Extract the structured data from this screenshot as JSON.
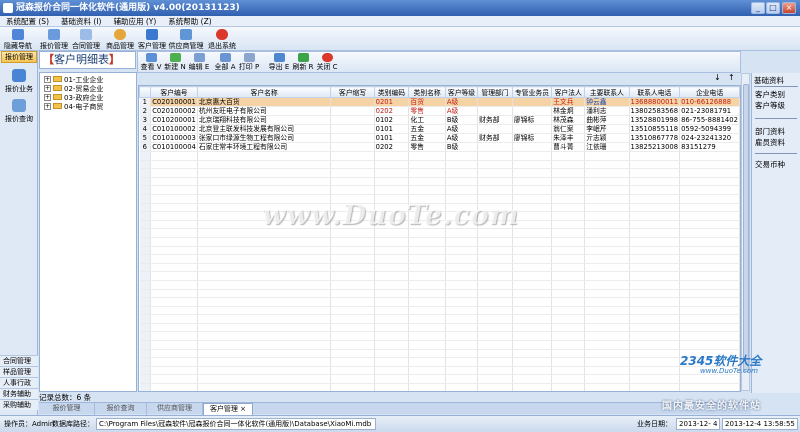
{
  "window": {
    "title": "冠森报价合同一体化软件(通用版) v4.00(20131123)",
    "controls": [
      "_",
      "□",
      "×"
    ]
  },
  "menu": [
    "系统配置 (S)",
    "基础资料 (I)",
    "辅助应用 (Y)",
    "系统帮助 (Z)"
  ],
  "toolbar": [
    "隐藏导航",
    "报价管理",
    "合同管理",
    "商品管理",
    "客户管理",
    "供应商管理",
    "退出系统"
  ],
  "nav": {
    "header": "报价管理",
    "items": [
      "报价业务",
      "报价查询"
    ],
    "bottom": [
      "合同管理",
      "样品管理",
      "人事行政",
      "财务辅助",
      "采购辅助"
    ]
  },
  "content": {
    "title": "客户明细表",
    "toolbar": [
      "查看 V",
      "新建 N",
      "编辑 E",
      "全部 A",
      "打印 P",
      "导出 E",
      "刷新 R",
      "关闭 C"
    ],
    "sort_controls": [
      "↓",
      "↑"
    ]
  },
  "tree": {
    "items": [
      "01-工业企业",
      "02-贸易企业",
      "03-政府企业",
      "04-电子商贸"
    ]
  },
  "table": {
    "columns": [
      "",
      "客户编号",
      "客户名称",
      "客户缩写",
      "类别编码",
      "类别名称",
      "客户等级",
      "管理部门",
      "专管业务员",
      "客户法人",
      "主要联系人",
      "联系人电话",
      "企业电话"
    ],
    "rows": [
      {
        "rn": "1",
        "sel": true,
        "cells": [
          "C020100001",
          "北京惠大百货",
          "",
          "0201",
          "百货",
          "A级",
          "",
          "",
          "王文兵",
          "钟云鑫",
          "13688800011",
          "010-66126888"
        ]
      },
      {
        "rn": "2",
        "sel": false,
        "cells": [
          "C020100002",
          "杭州友旺电子有限公司",
          "",
          "0202",
          "零售",
          "A级",
          "",
          "",
          "林金炯",
          "潘利志",
          "13802583568",
          "021-23081791"
        ]
      },
      {
        "rn": "3",
        "sel": false,
        "cells": [
          "C010200001",
          "北京瑞翔科技有限公司",
          "",
          "0102",
          "化工",
          "B级",
          "财务部",
          "廖锦标",
          "林茂森",
          "曲彬萍",
          "13528801998",
          "86-755-8881402"
        ]
      },
      {
        "rn": "4",
        "sel": false,
        "cells": [
          "C010100002",
          "北京登主联发科技发展有限公司",
          "",
          "0101",
          "五金",
          "A级",
          "",
          "",
          "翁仁案",
          "李岷芹",
          "13510855118",
          "0592-5094399"
        ]
      },
      {
        "rn": "5",
        "sel": false,
        "cells": [
          "C010100003",
          "张家口市绿源生物工程有限公司",
          "",
          "0101",
          "五金",
          "A级",
          "财务部",
          "廖锦标",
          "朱泽丰",
          "亓志颖",
          "13510867778",
          "024-23241320"
        ]
      },
      {
        "rn": "6",
        "sel": false,
        "cells": [
          "C010100004",
          "石家庄常丰环境工程有限公司",
          "",
          "0202",
          "零售",
          "B级",
          "",
          "",
          "曹斗菁",
          "江依珊",
          "13825213008",
          "83151279"
        ]
      }
    ]
  },
  "right_panel": {
    "header": "基础资料",
    "groups": [
      [
        "客户类别",
        "客户等级"
      ],
      [
        "部门资料",
        "雇员资料"
      ],
      [
        "交易币种"
      ]
    ]
  },
  "record_count": "记录总数：6 条",
  "tabs": [
    {
      "label": "报价管理",
      "active": false
    },
    {
      "label": "报价查询",
      "active": false
    },
    {
      "label": "供应商管理",
      "active": false
    },
    {
      "label": "客户管理",
      "active": true
    }
  ],
  "tab_close": "×",
  "status": {
    "operator": "操作员：Admin",
    "db_label": "数据库路径：",
    "db_path": "C:\\Program Files\\冠森软件\\冠森报价合同一体化软件(通用版)\\Database\\XiaoMi.mdb",
    "biz_label": "业务日期：",
    "biz_date": "2013-12- 4",
    "datetime": "2013-12-4 13:58:55"
  },
  "watermarks": {
    "center": "www.DuoTe.com",
    "logo": "2345软件大全",
    "logo_sub": "www.DuoTe.com",
    "slogan": "国内最安全的软件站"
  },
  "colors": {
    "accent": "#2f60b0",
    "selection": "#f6d3a4",
    "code_red": "#c0201a",
    "contact_blue": "#1a46b0"
  }
}
